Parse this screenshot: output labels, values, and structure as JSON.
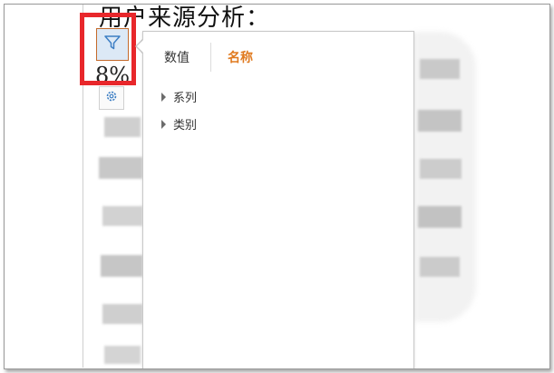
{
  "document": {
    "title": "用户来源分析：",
    "fragment": "8%"
  },
  "toolbar": {
    "filter_icon": "funnel-icon",
    "settings_icon": "gear-icon"
  },
  "filter_panel": {
    "tabs": [
      {
        "label": "数值",
        "active": false
      },
      {
        "label": "名称",
        "active": true
      }
    ],
    "tree_items": [
      {
        "label": "系列"
      },
      {
        "label": "类别"
      }
    ]
  },
  "colors": {
    "highlight": "#e8272b",
    "active_tab": "#e07a1f",
    "filter_button_bg": "#dce9f6"
  }
}
